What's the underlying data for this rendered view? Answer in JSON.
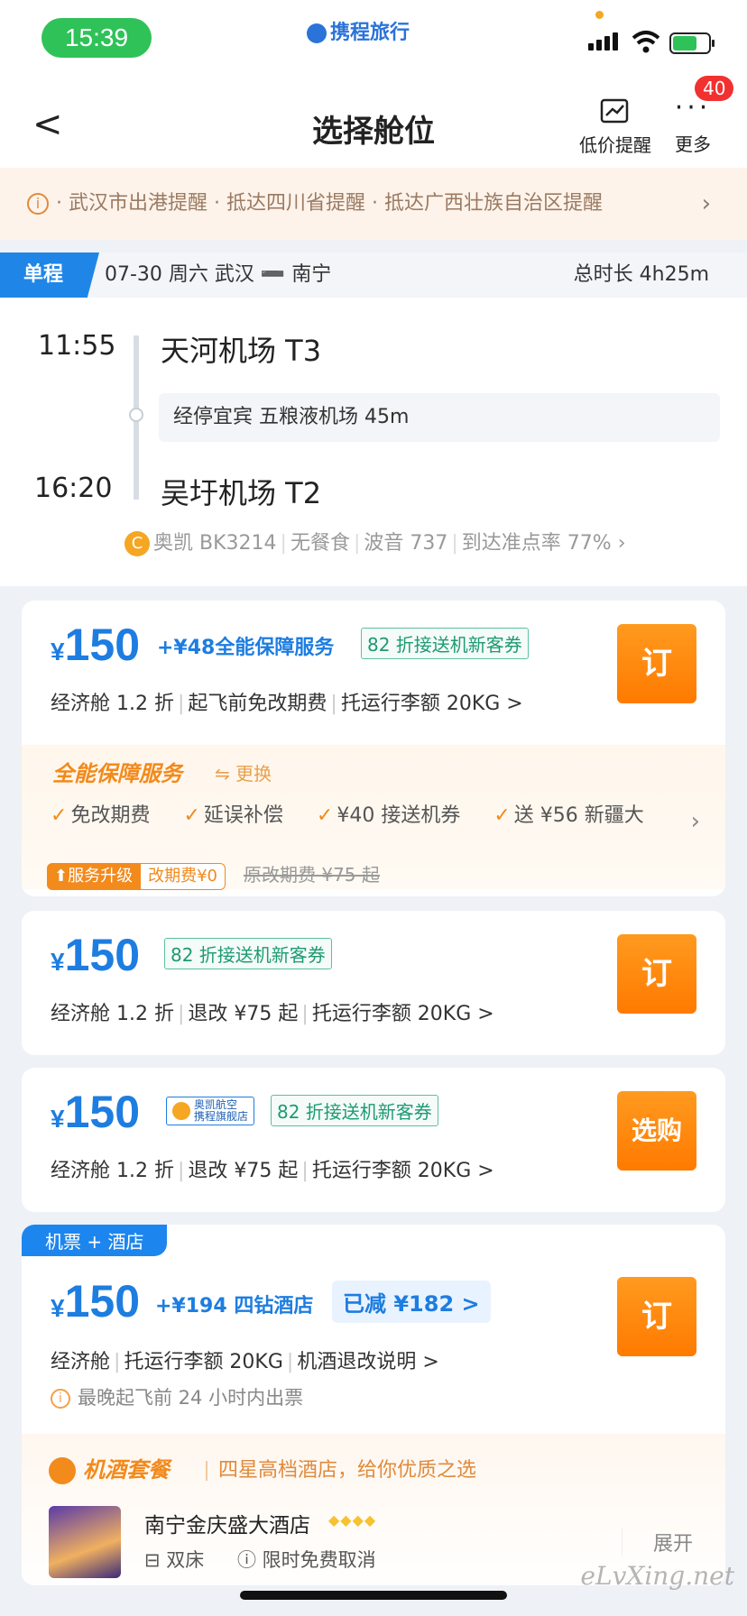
{
  "status": {
    "time": "15:39",
    "brand": "携程旅行"
  },
  "header": {
    "back": "<",
    "title": "选择舱位",
    "alert_label": "低价提醒",
    "more_label": "更多",
    "badge": "40"
  },
  "notice": {
    "text": "· 武汉市出港提醒  · 抵达四川省提醒  · 抵达广西壮族自治区提醒"
  },
  "trip": {
    "tag": "单程",
    "info": "07-30 周六   武汉 ➖ 南宁",
    "duration": "总时长 4h25m",
    "dep_time": "11:55",
    "dep_port": "天河机场 T3",
    "stop": "经停宜宾 五粮液机场 45m",
    "arr_time": "16:20",
    "arr_port": "吴圩机场 T2",
    "carrier": [
      "奥凯 BK3214",
      "无餐食",
      "波音 737",
      "到达准点率 77%"
    ]
  },
  "cards": [
    {
      "price": "150",
      "addon": "+¥48全能保障服务",
      "coupon": "82 折接送机新客券",
      "details": [
        "经济舱 1.2 折",
        "起飞前免改期费",
        "托运行李额 20KG >"
      ],
      "button": "订",
      "service": {
        "title": "全能保障服务",
        "switch": "⇋ 更换",
        "items": [
          "免改期费",
          "延误补偿",
          "¥40 接送机券",
          "送 ¥56 新疆大"
        ],
        "upgrade_a": "⬆服务升级",
        "upgrade_b": "改期费¥0",
        "orig": "原改期费 ¥75 起"
      }
    },
    {
      "price": "150",
      "coupon": "82 折接送机新客券",
      "details": [
        "经济舱 1.2 折",
        "退改 ¥75 起",
        "托运行李额 20KG >"
      ],
      "button": "订"
    },
    {
      "price": "150",
      "flagship_1": "奥凯航空",
      "flagship_2": "携程旗舰店",
      "coupon": "82 折接送机新客券",
      "details": [
        "经济舱 1.2 折",
        "退改 ¥75 起",
        "托运行李额 20KG >"
      ],
      "button": "选购"
    },
    {
      "flag": "机票 + 酒店",
      "price": "150",
      "addon": "+¥194 四钻酒店",
      "discount": "已减 ¥182 >",
      "details": [
        "经济舱",
        "托运行李额 20KG",
        "机酒退改说明 >"
      ],
      "issue": "最晚起飞前 24 小时内出票",
      "button": "订",
      "package": {
        "title": "机酒套餐",
        "subtitle": "四星高档酒店，给你优质之选",
        "hotel": "南宁金庆盛大酒店",
        "stars": "◆◆◆◆",
        "bed": "双床",
        "cancel": "限时免费取消",
        "expand": "展开"
      }
    }
  ],
  "watermark": "eLvXing.net",
  "colors": {
    "accent": "#1d7de0",
    "orange": "#ff8a00",
    "green": "#2fc258"
  }
}
